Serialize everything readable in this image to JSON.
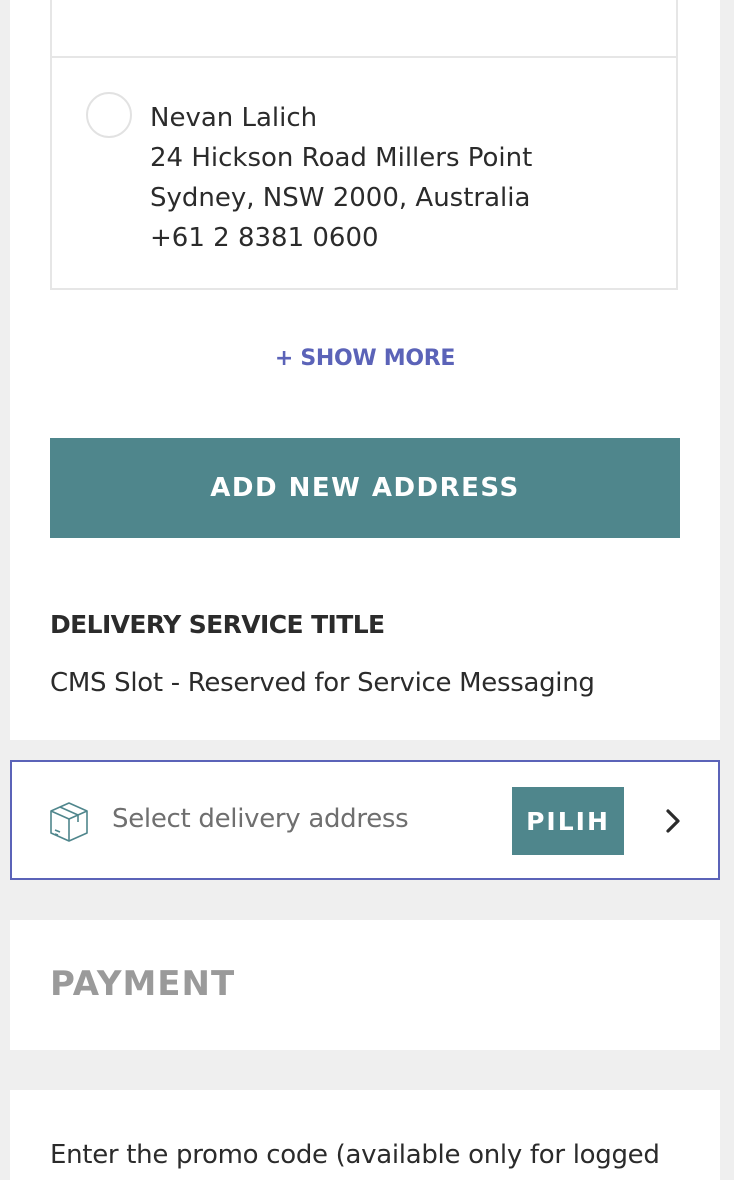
{
  "addresses": [
    {
      "lines": [
        "+61 2 8381 0600"
      ]
    },
    {
      "name": "Nevan Lalich",
      "street": "24 Hickson Road Millers Point",
      "city": "Sydney, NSW 2000, Australia",
      "phone": "+61 2 8381 0600"
    }
  ],
  "show_more_label": "+ SHOW MORE",
  "add_address_label": "ADD NEW ADDRESS",
  "delivery_service": {
    "title": "DELIVERY SERVICE TITLE",
    "message": "CMS Slot - Reserved for Service Messaging"
  },
  "delivery_selector": {
    "icon": "package-box-icon",
    "label": "Select delivery address",
    "button_label": "PILIH",
    "chevron": "chevron-right-icon"
  },
  "payment": {
    "heading": "PAYMENT"
  },
  "promo": {
    "text": "Enter the promo code (available only for logged"
  },
  "colors": {
    "accent_teal": "#4f868c",
    "link_blue": "#5b63b8",
    "background": "#efefef",
    "text_dark": "#2b2b2b",
    "muted": "#9a9a9a"
  }
}
